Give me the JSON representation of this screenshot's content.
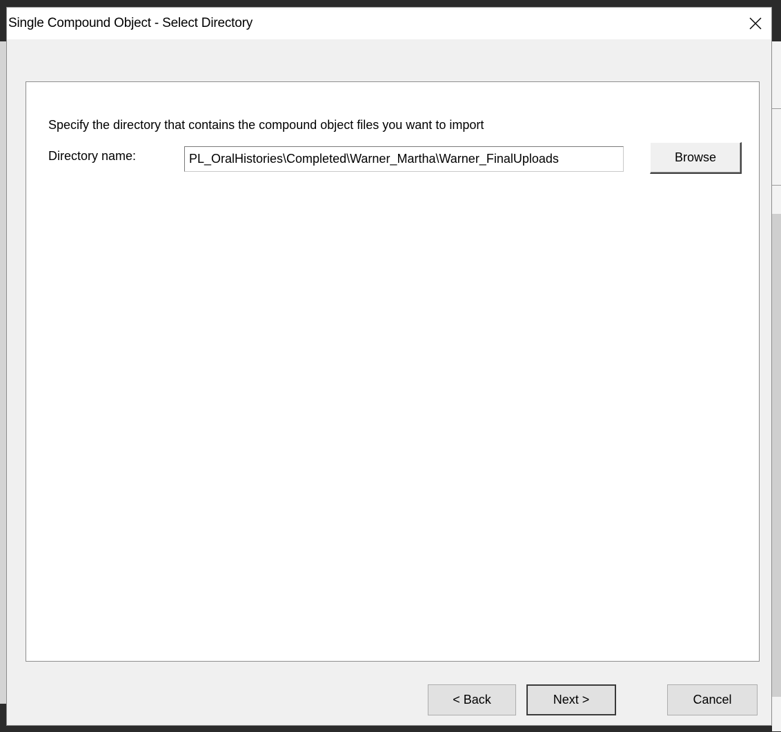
{
  "window": {
    "title": "Single Compound Object - Select Directory"
  },
  "content": {
    "instruction": "Specify the directory that contains the compound object files you want to import",
    "directory_label": "Directory name:",
    "directory_value": "PL_OralHistories\\Completed\\Warner_Martha\\Warner_FinalUploads",
    "browse_label": "Browse"
  },
  "footer": {
    "back_label": "< Back",
    "next_label": "Next >",
    "cancel_label": "Cancel"
  },
  "icons": {
    "close": "close-icon"
  }
}
